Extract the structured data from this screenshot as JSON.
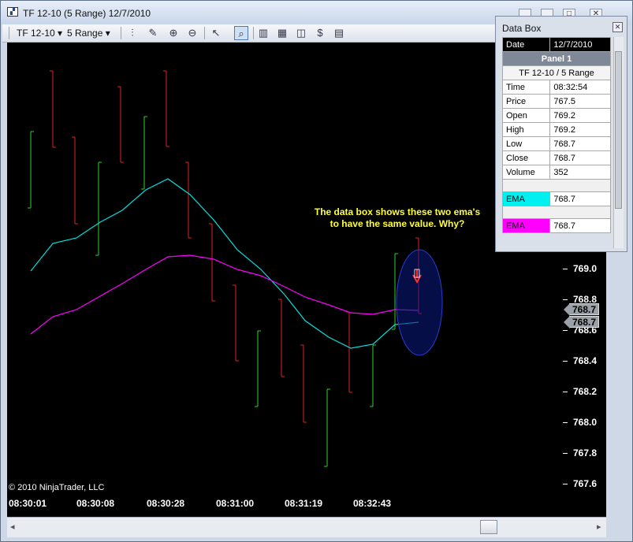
{
  "window": {
    "title": "TF 12-10 (5 Range)  12/7/2010",
    "min_glyph": "▁",
    "max_glyph": "□",
    "close_glyph": "✕"
  },
  "toolbar": {
    "instrument": "TF 12-10",
    "period": "5 Range",
    "dropdown_glyph": "▾"
  },
  "chart": {
    "copyright": "© 2010 NinjaTrader, LLC",
    "annotation_line1": "The data box shows these two  ema's",
    "annotation_line2": "to have the same value. Why?",
    "y_labels": [
      "769.0",
      "768.8",
      "768.6",
      "768.4",
      "768.2",
      "768.0",
      "767.8",
      "767.6"
    ],
    "x_labels": [
      "08:30:01",
      "08:30:08",
      "08:30:28",
      "08:31:00",
      "08:31:19",
      "08:32:43"
    ],
    "price_tag_1": "768.7",
    "price_tag_2": "768.7"
  },
  "chart_data": {
    "type": "line",
    "title": "",
    "y_axis_range": [
      767.6,
      769.0
    ],
    "bars": [
      {
        "x": 0,
        "color": "green"
      },
      {
        "x": 1,
        "color": "red"
      },
      {
        "x": 2,
        "color": "red"
      },
      {
        "x": 3,
        "color": "green"
      },
      {
        "x": 4,
        "color": "red"
      },
      {
        "x": 5,
        "color": "green"
      },
      {
        "x": 6,
        "color": "red"
      },
      {
        "x": 7,
        "color": "red"
      },
      {
        "x": 8,
        "color": "red"
      },
      {
        "x": 9,
        "color": "red"
      },
      {
        "x": 10,
        "color": "green"
      },
      {
        "x": 11,
        "color": "red"
      },
      {
        "x": 12,
        "color": "red"
      },
      {
        "x": 13,
        "color": "green"
      },
      {
        "x": 14,
        "color": "red"
      },
      {
        "x": 15,
        "color": "green"
      },
      {
        "x": 16,
        "color": "green"
      },
      {
        "x": 17,
        "color": "red"
      }
    ],
    "series": [
      {
        "color": "#00e5e5"
      },
      {
        "color": "#ff00ff"
      }
    ]
  },
  "databox": {
    "title": "Data Box",
    "close_glyph": "✕",
    "date_label": "Date",
    "date_value": "12/7/2010",
    "panel": "Panel 1",
    "instrument": "TF 12-10 / 5 Range",
    "rows": [
      {
        "label": "Time",
        "value": "08:32:54"
      },
      {
        "label": "Price",
        "value": "767.5"
      },
      {
        "label": "Open",
        "value": "769.2"
      },
      {
        "label": "High",
        "value": "769.2"
      },
      {
        "label": "Low",
        "value": "768.7"
      },
      {
        "label": "Close",
        "value": "768.7"
      },
      {
        "label": "Volume",
        "value": "352"
      }
    ],
    "ema1_label": "EMA",
    "ema1_value": "768.7",
    "ema2_label": "EMA",
    "ema2_value": "768.7"
  }
}
